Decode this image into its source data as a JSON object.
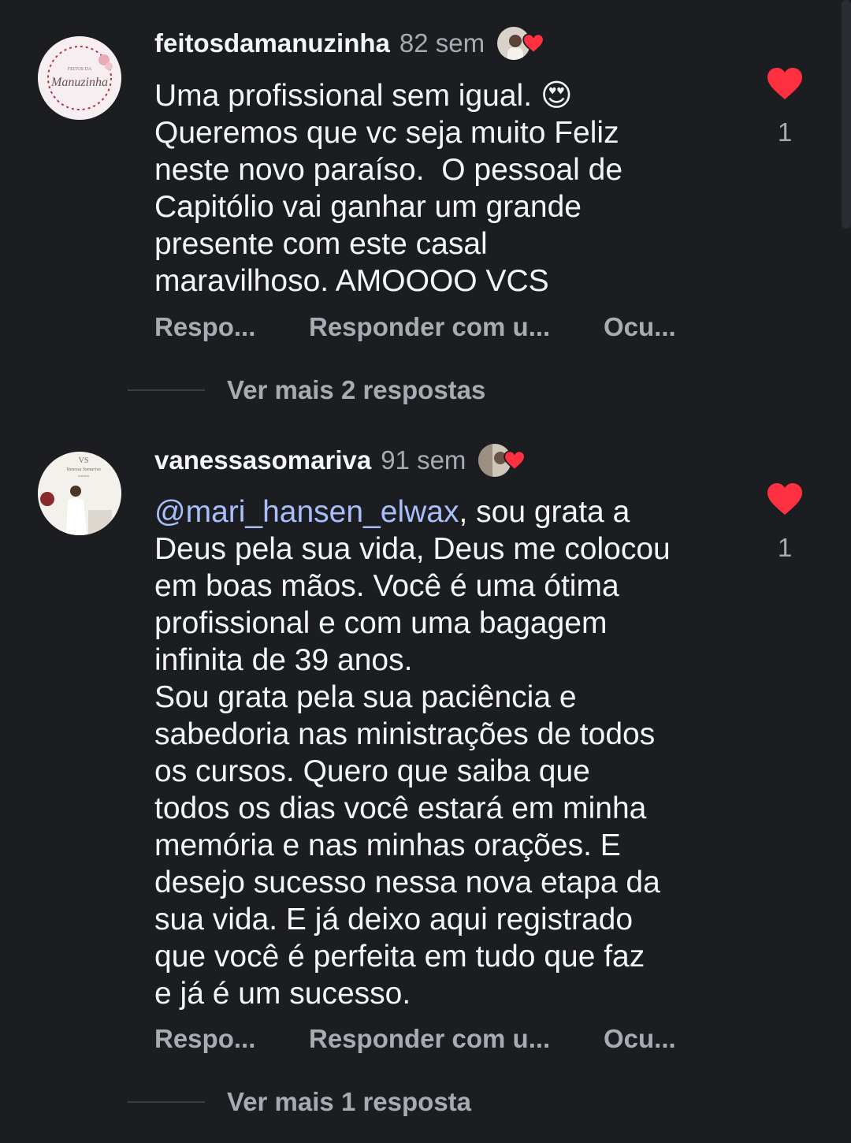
{
  "comments": [
    {
      "username": "feitosdamanuzinha",
      "time": "82 sem",
      "avatar_text_top": "FEITOS DA",
      "avatar_text_main": "Manuzinha",
      "text": "Uma profissional sem igual. 😍\nQueremos que vc seja muito Feliz\nneste novo paraíso.  O pessoal de\nCapitólio vai ganhar um grande\npresente com este casal\nmaravilhoso. AMOOOO VCS",
      "like_count": "1",
      "actions": [
        "Respo...",
        "Responder com u...",
        "Ocu..."
      ],
      "more_replies": "Ver mais 2 respostas"
    },
    {
      "username": "vanessasomariva",
      "time": "91 sem",
      "avatar_text_top": "VS",
      "avatar_text_main": "Vanessa Somariva",
      "avatar_text_sub": "estetica",
      "mention": "@mari_hansen_elwax",
      "text": ", sou grata a\nDeus pela sua vida, Deus me colocou\nem boas mãos. Você é uma ótima\nprofissional e com uma bagagem\ninfinita de 39 anos.\nSou grata pela sua paciência e\nsabedoria nas ministrações de todos\nos cursos. Quero que saiba que\ntodos os dias você estará em minha\nmemória e nas minhas orações. E\ndesejo sucesso nessa nova etapa da\nsua vida. E já deixo aqui registrado\nque você é perfeita em tudo que faz\ne já é um sucesso.",
      "like_count": "1",
      "actions": [
        "Respo...",
        "Responder com u...",
        "Ocu..."
      ],
      "more_replies": "Ver mais 1 resposta"
    }
  ],
  "colors": {
    "background": "#1b1d21",
    "heart": "#ff3040",
    "mention": "#a9bffb",
    "secondary_text": "#a8abb2"
  },
  "icons": {
    "like": "heart-icon",
    "liked_by_author": "small-heart-icon"
  }
}
